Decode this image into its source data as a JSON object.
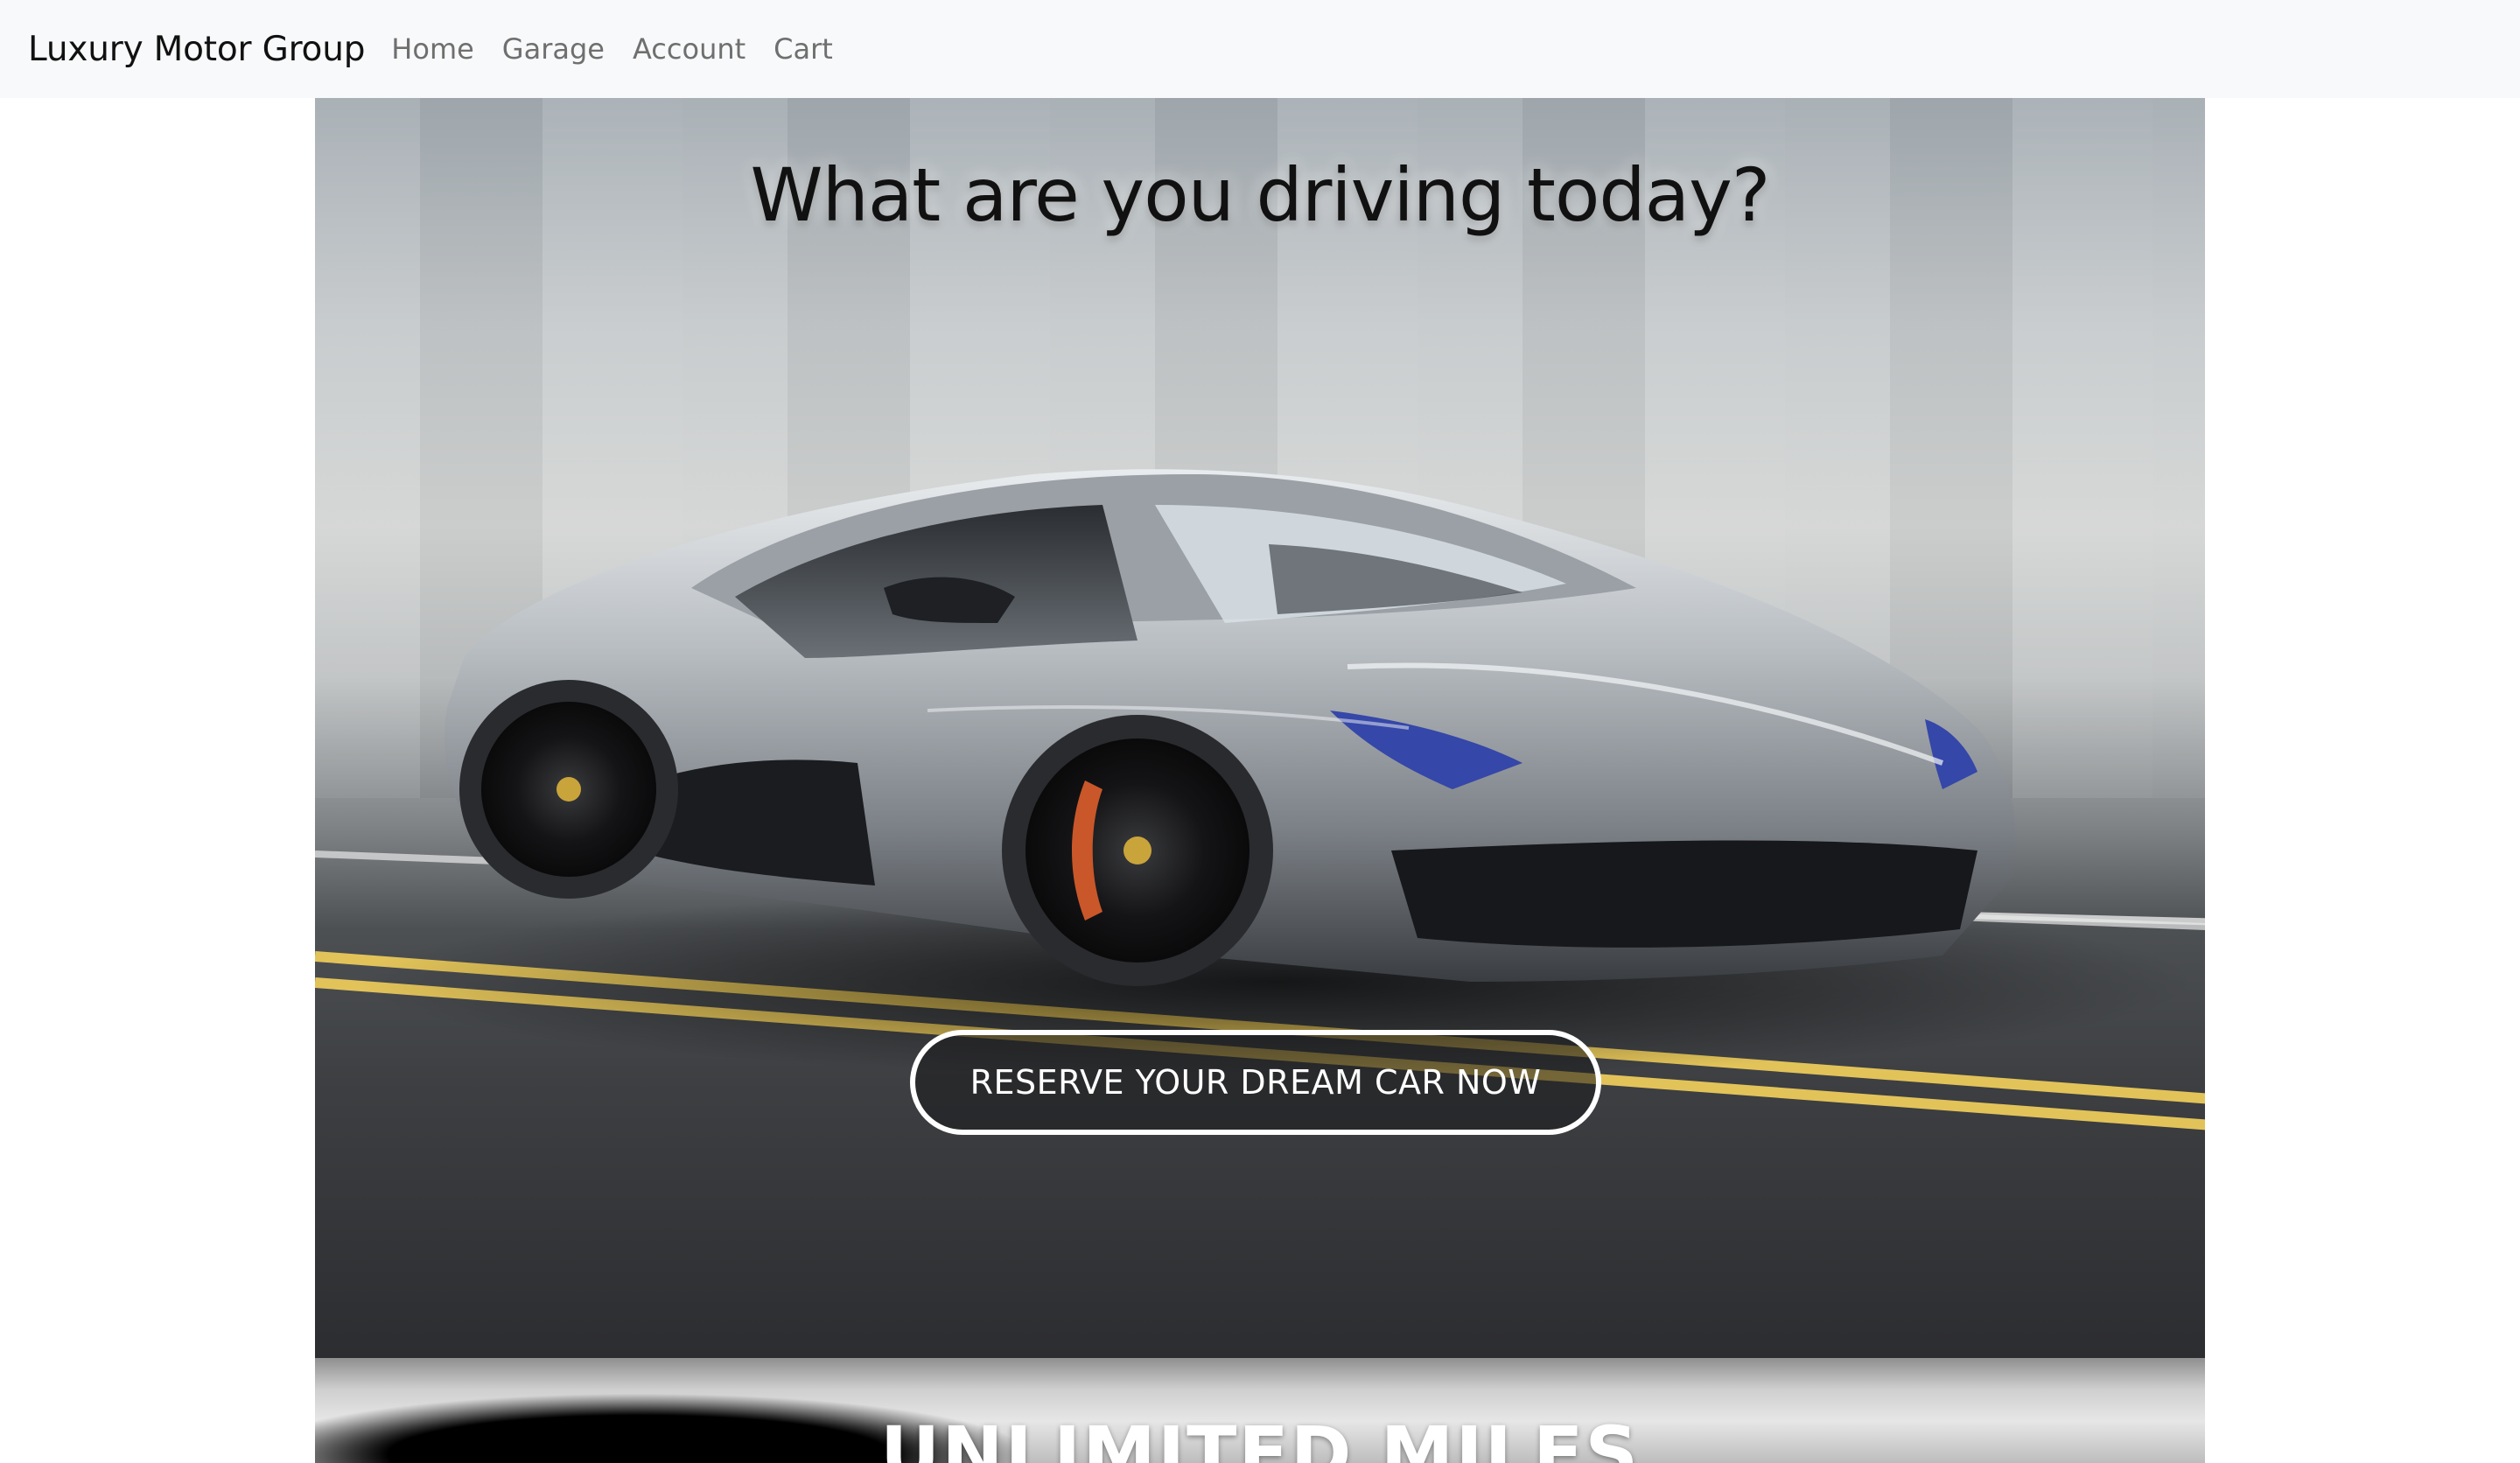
{
  "navbar": {
    "brand": "Luxury Motor Group",
    "links": [
      "Home",
      "Garage",
      "Account",
      "Cart"
    ]
  },
  "hero": {
    "title": "What are you driving today?",
    "cta_label": "RESERVE YOUR DREAM CAR NOW",
    "image": "silver-sports-car-photo"
  },
  "section2": {
    "title": "UNLIMITED MILES"
  },
  "colors": {
    "navbar_bg": "#f8f9fa",
    "brand_text": "#111111",
    "nav_link": "#6f6f6f",
    "cta_border": "#ffffff"
  }
}
